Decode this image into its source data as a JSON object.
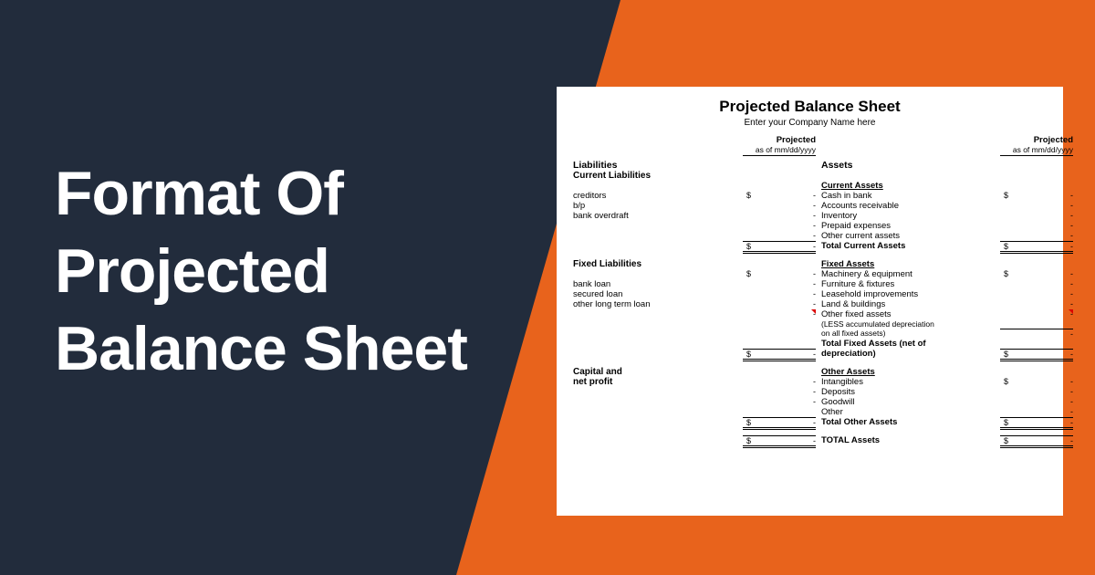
{
  "hero": {
    "title_l1": "Format Of",
    "title_l2": "Projected",
    "title_l3": "Balance Sheet"
  },
  "sheet": {
    "title": "Projected Balance Sheet",
    "subtitle": "Enter your Company Name here",
    "col_projected": "Projected",
    "col_date": "as of mm/dd/yyyy",
    "liab_hdr": "Liabilities",
    "cur_liab_hdr": "Current Liabilities",
    "cur_liab": {
      "creditors": "creditors",
      "bp": "b/p",
      "overdraft": "bank overdraft"
    },
    "fixed_liab_hdr": "Fixed Liabilities",
    "fixed_liab": {
      "bank_loan": "bank loan",
      "secured": "secured loan",
      "other": "other long term loan"
    },
    "capital_hdr_l1": "Capital and",
    "capital_hdr_l2": "net profit",
    "assets_hdr": "Assets",
    "cur_assets_hdr": "Current Assets",
    "cur_assets": {
      "cash": "Cash in bank",
      "ar": "Accounts receivable",
      "inv": "Inventory",
      "prepaid": "Prepaid expenses",
      "other": "Other current assets"
    },
    "cur_assets_total": "Total Current Assets",
    "fixed_assets_hdr": "Fixed Assets",
    "fixed_assets": {
      "mach": "Machinery & equipment",
      "furn": "Furniture & fixtures",
      "lease": "Leasehold improvements",
      "land": "Land & buildings",
      "other": "Other fixed assets"
    },
    "fixed_note_l1": "(LESS accumulated depreciation",
    "fixed_note_l2": "on all fixed assets)",
    "fixed_total_l1": "Total Fixed Assets (net of",
    "fixed_total_l2": "depreciation)",
    "other_assets_hdr": "Other Assets",
    "other_assets": {
      "intang": "Intangibles",
      "deposits": "Deposits",
      "goodwill": "Goodwill",
      "other": "Other"
    },
    "other_total": "Total Other Assets",
    "grand_total": "TOTAL Assets",
    "dash": "-",
    "dollar": "$"
  }
}
